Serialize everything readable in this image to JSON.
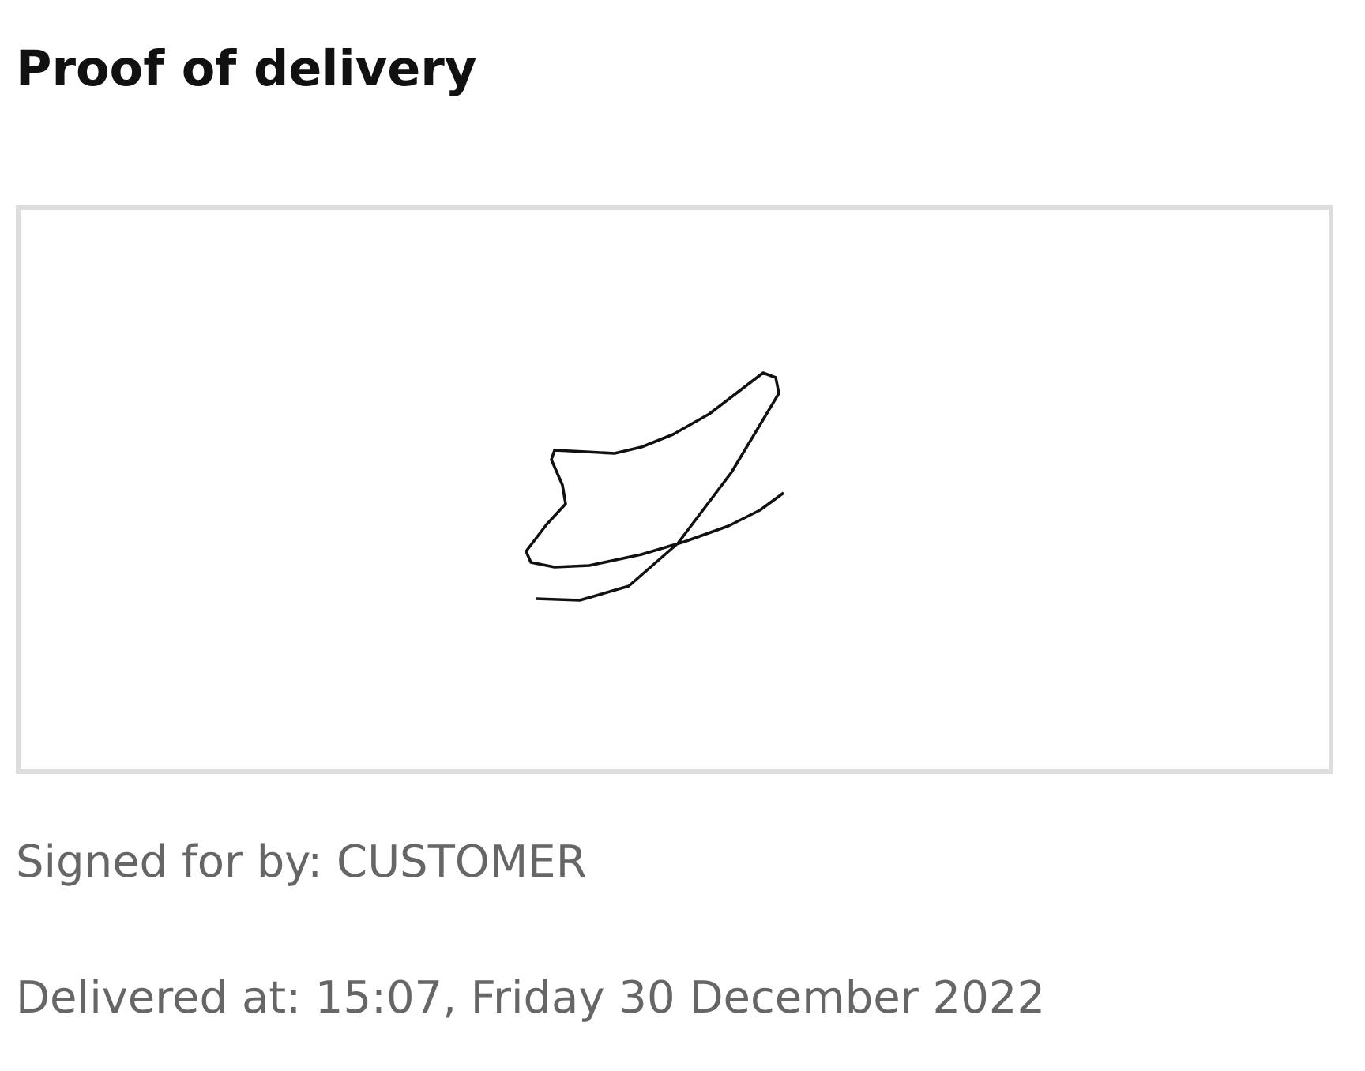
{
  "title": "Proof of delivery",
  "details": [
    "Signed for by: CUSTOMER",
    "Delivered at: 15:07, Friday 30 December 2022"
  ]
}
